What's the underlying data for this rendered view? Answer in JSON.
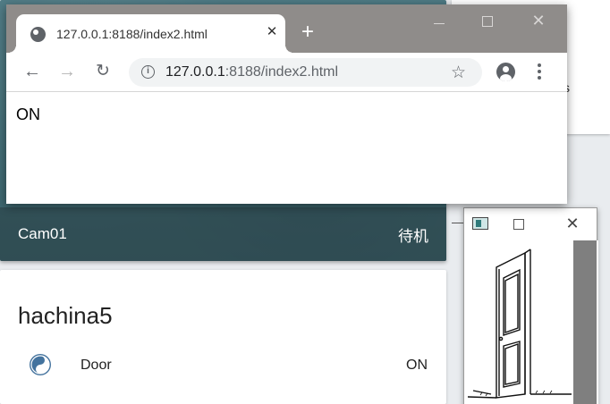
{
  "ha": {
    "camera_card": {
      "name": "Cam01",
      "state": "待机"
    },
    "right_card_fragment": "s",
    "entity_card": {
      "title": "hachina5",
      "entity_name": "Door",
      "entity_state": "ON",
      "icon": "yin-yang-icon"
    }
  },
  "browser": {
    "tab_title": "127.0.0.1:8188/index2.html",
    "tab_close": "✕",
    "new_tab": "+",
    "close_glyph": "✕",
    "url_host": "127.0.0.1",
    "url_rest": ":8188/index2.html",
    "page_text": "ON",
    "back": "←",
    "forward": "→",
    "reload": "↻",
    "star": "☆",
    "info": "i"
  },
  "image_window": {
    "close_glyph": "✕",
    "image": "open-door-drawing"
  }
}
